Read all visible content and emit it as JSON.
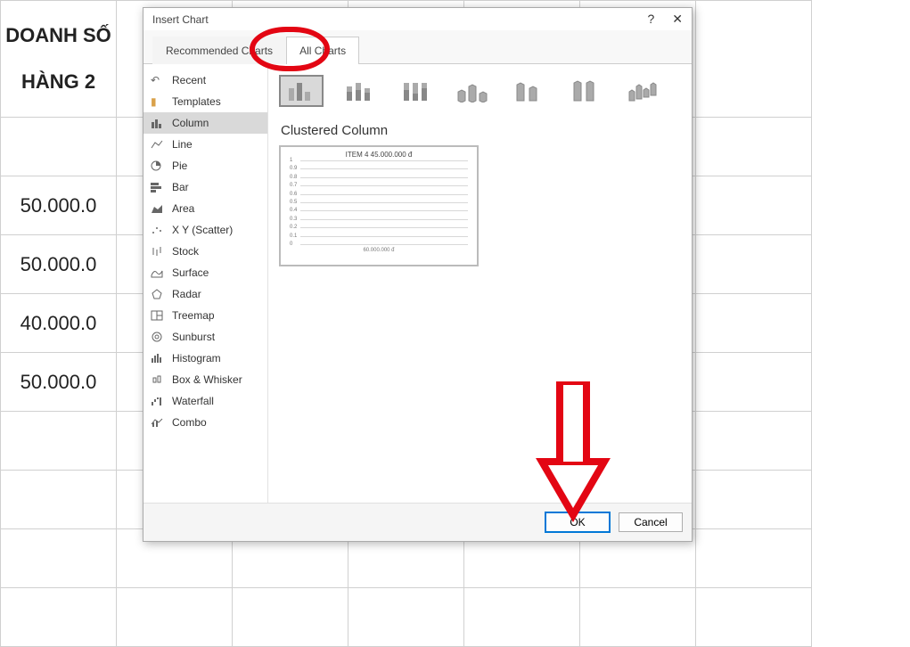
{
  "sheet": {
    "title_line1": "DOANH SỐ",
    "title_line2": "HÀNG 2",
    "rows": [
      "50.000.0",
      "50.000.0",
      "40.000.0",
      "50.000.0"
    ]
  },
  "dialog": {
    "title": "Insert Chart",
    "help": "?",
    "tabs": {
      "recommended": "Recommended Charts",
      "all": "All Charts"
    },
    "chart_types": [
      {
        "icon": "recent",
        "label": "Recent"
      },
      {
        "icon": "templates",
        "label": "Templates"
      },
      {
        "icon": "column",
        "label": "Column",
        "active": true
      },
      {
        "icon": "line",
        "label": "Line"
      },
      {
        "icon": "pie",
        "label": "Pie"
      },
      {
        "icon": "bar",
        "label": "Bar"
      },
      {
        "icon": "area",
        "label": "Area"
      },
      {
        "icon": "scatter",
        "label": "X Y (Scatter)"
      },
      {
        "icon": "stock",
        "label": "Stock"
      },
      {
        "icon": "surface",
        "label": "Surface"
      },
      {
        "icon": "radar",
        "label": "Radar"
      },
      {
        "icon": "treemap",
        "label": "Treemap"
      },
      {
        "icon": "sunburst",
        "label": "Sunburst"
      },
      {
        "icon": "histogram",
        "label": "Histogram"
      },
      {
        "icon": "boxwhisker",
        "label": "Box & Whisker"
      },
      {
        "icon": "waterfall",
        "label": "Waterfall"
      },
      {
        "icon": "combo",
        "label": "Combo"
      }
    ],
    "subtype_heading": "Clustered Column",
    "preview": {
      "title": "ITEM 4 45.000.000 đ",
      "yticks": [
        "1",
        "0.9",
        "0.8",
        "0.7",
        "0.6",
        "0.5",
        "0.4",
        "0.3",
        "0.2",
        "0.1",
        "0"
      ],
      "footer": "60.000.000 đ"
    },
    "buttons": {
      "ok": "OK",
      "cancel": "Cancel"
    }
  },
  "chart_data": {
    "type": "bar",
    "title": "ITEM 4 45.000.000 đ",
    "categories": [
      "ITEM 4"
    ],
    "values": [
      45000000
    ],
    "ylabel": "",
    "xlabel": "",
    "ylim": [
      0,
      1
    ],
    "ytick_labels": [
      "0",
      "0.1",
      "0.2",
      "0.3",
      "0.4",
      "0.5",
      "0.6",
      "0.7",
      "0.8",
      "0.9",
      "1"
    ]
  }
}
